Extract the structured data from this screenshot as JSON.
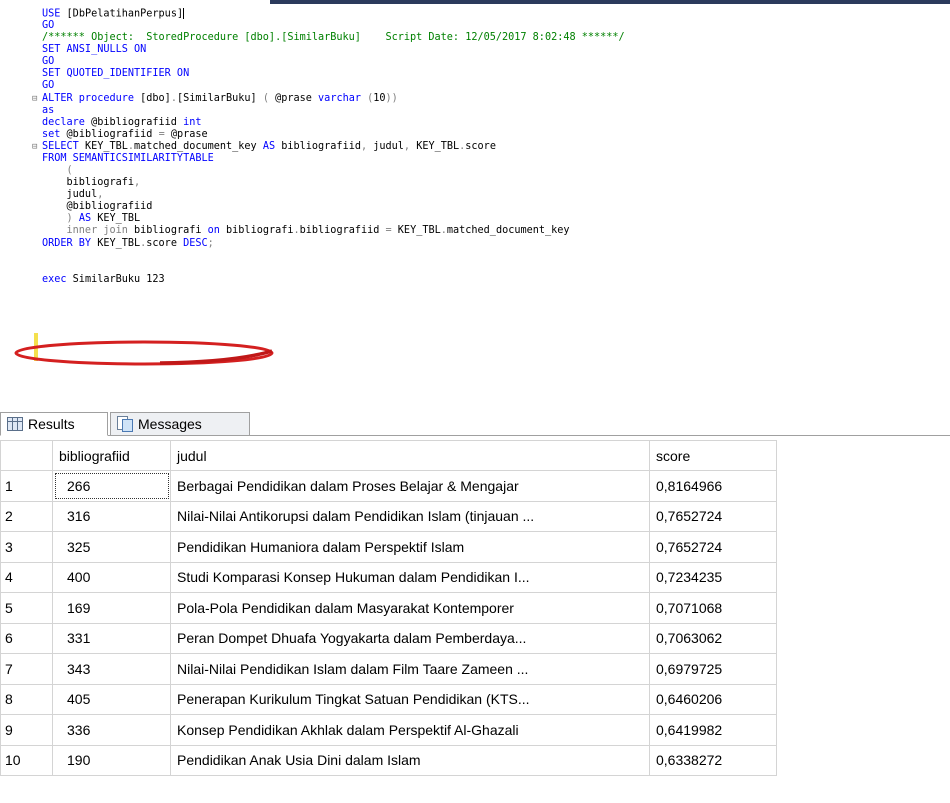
{
  "editor": {
    "lines": [
      {
        "fold": "",
        "parts": [
          {
            "c": "kw",
            "t": "USE "
          },
          {
            "c": "id",
            "t": "[DbPelatihanPerpus]"
          }
        ]
      },
      {
        "fold": "",
        "parts": [
          {
            "c": "kw",
            "t": "GO"
          }
        ]
      },
      {
        "fold": "",
        "parts": [
          {
            "c": "cm",
            "t": "/****** Object:  StoredProcedure [dbo].[SimilarBuku]    Script Date: 12/05/2017 8:02:48 ******/"
          }
        ]
      },
      {
        "fold": "",
        "parts": [
          {
            "c": "kw",
            "t": "SET ANSI_NULLS ON"
          }
        ]
      },
      {
        "fold": "",
        "parts": [
          {
            "c": "kw",
            "t": "GO"
          }
        ]
      },
      {
        "fold": "",
        "parts": [
          {
            "c": "kw",
            "t": "SET QUOTED_IDENTIFIER ON"
          }
        ]
      },
      {
        "fold": "",
        "parts": [
          {
            "c": "kw",
            "t": "GO"
          }
        ]
      },
      {
        "fold": "⊟",
        "parts": [
          {
            "c": "kw",
            "t": "ALTER procedure "
          },
          {
            "c": "id",
            "t": "[dbo]"
          },
          {
            "c": "gr",
            "t": "."
          },
          {
            "c": "id",
            "t": "[SimilarBuku] "
          },
          {
            "c": "gr",
            "t": "( "
          },
          {
            "c": "id",
            "t": "@prase "
          },
          {
            "c": "kw",
            "t": "varchar "
          },
          {
            "c": "gr",
            "t": "("
          },
          {
            "c": "id",
            "t": "10"
          },
          {
            "c": "gr",
            "t": "))"
          }
        ]
      },
      {
        "fold": "",
        "parts": [
          {
            "c": "kw",
            "t": "as"
          }
        ]
      },
      {
        "fold": "",
        "parts": [
          {
            "c": "kw",
            "t": "declare "
          },
          {
            "c": "id",
            "t": "@bibliografiid "
          },
          {
            "c": "kw",
            "t": "int"
          }
        ]
      },
      {
        "fold": "",
        "parts": [
          {
            "c": "kw",
            "t": "set "
          },
          {
            "c": "id",
            "t": "@bibliografiid "
          },
          {
            "c": "gr",
            "t": "= "
          },
          {
            "c": "id",
            "t": "@prase"
          }
        ]
      },
      {
        "fold": "⊟",
        "parts": [
          {
            "c": "kw",
            "t": "SELECT "
          },
          {
            "c": "id",
            "t": "KEY_TBL"
          },
          {
            "c": "gr",
            "t": "."
          },
          {
            "c": "id",
            "t": "matched_document_key "
          },
          {
            "c": "kw",
            "t": "AS "
          },
          {
            "c": "id",
            "t": "bibliografiid"
          },
          {
            "c": "gr",
            "t": ", "
          },
          {
            "c": "id",
            "t": "judul"
          },
          {
            "c": "gr",
            "t": ", "
          },
          {
            "c": "id",
            "t": "KEY_TBL"
          },
          {
            "c": "gr",
            "t": "."
          },
          {
            "c": "id",
            "t": "score"
          }
        ]
      },
      {
        "fold": "",
        "parts": [
          {
            "c": "kw",
            "t": "FROM SEMANTICSIMILARITYTABLE"
          }
        ]
      },
      {
        "fold": "",
        "parts": [
          {
            "c": "gr",
            "t": "    ("
          }
        ]
      },
      {
        "fold": "",
        "parts": [
          {
            "c": "id",
            "t": "    bibliografi"
          },
          {
            "c": "gr",
            "t": ","
          }
        ]
      },
      {
        "fold": "",
        "parts": [
          {
            "c": "id",
            "t": "    judul"
          },
          {
            "c": "gr",
            "t": ","
          }
        ]
      },
      {
        "fold": "",
        "parts": [
          {
            "c": "id",
            "t": "    @bibliografiid"
          }
        ]
      },
      {
        "fold": "",
        "parts": [
          {
            "c": "gr",
            "t": "    ) "
          },
          {
            "c": "kw",
            "t": "AS "
          },
          {
            "c": "id",
            "t": "KEY_TBL"
          }
        ]
      },
      {
        "fold": "",
        "parts": [
          {
            "c": "gr",
            "t": "    inner join "
          },
          {
            "c": "id",
            "t": "bibliografi "
          },
          {
            "c": "kw",
            "t": "on "
          },
          {
            "c": "id",
            "t": "bibliografi"
          },
          {
            "c": "gr",
            "t": "."
          },
          {
            "c": "id",
            "t": "bibliografiid "
          },
          {
            "c": "gr",
            "t": "= "
          },
          {
            "c": "id",
            "t": "KEY_TBL"
          },
          {
            "c": "gr",
            "t": "."
          },
          {
            "c": "id",
            "t": "matched_document_key"
          }
        ]
      },
      {
        "fold": "",
        "parts": [
          {
            "c": "kw",
            "t": "ORDER BY "
          },
          {
            "c": "id",
            "t": "KEY_TBL"
          },
          {
            "c": "gr",
            "t": "."
          },
          {
            "c": "id",
            "t": "score "
          },
          {
            "c": "kw",
            "t": "DESC"
          },
          {
            "c": "gr",
            "t": ";"
          }
        ]
      },
      {
        "fold": "",
        "parts": []
      },
      {
        "fold": "",
        "parts": []
      },
      {
        "fold": "",
        "parts": [
          {
            "c": "kw",
            "t": "exec "
          },
          {
            "c": "id",
            "t": "SimilarBuku 123"
          }
        ]
      }
    ]
  },
  "results": {
    "tabs": {
      "results": "Results",
      "messages": "Messages"
    },
    "columns": [
      "bibliografiid",
      "judul",
      "score"
    ],
    "rows": [
      {
        "n": "1",
        "bibliografiid": "266",
        "judul": "Berbagai Pendidikan dalam Proses Belajar & Mengajar",
        "score": "0,8164966"
      },
      {
        "n": "2",
        "bibliografiid": "316",
        "judul": "Nilai-Nilai Antikorupsi dalam Pendidikan Islam (tinjauan ...",
        "score": "0,7652724"
      },
      {
        "n": "3",
        "bibliografiid": "325",
        "judul": "Pendidikan Humaniora dalam Perspektif Islam",
        "score": "0,7652724"
      },
      {
        "n": "4",
        "bibliografiid": "400",
        "judul": "Studi Komparasi Konsep Hukuman dalam Pendidikan I...",
        "score": "0,7234235"
      },
      {
        "n": "5",
        "bibliografiid": "169",
        "judul": "Pola-Pola Pendidikan dalam Masyarakat Kontemporer",
        "score": "0,7071068"
      },
      {
        "n": "6",
        "bibliografiid": "331",
        "judul": "Peran Dompet Dhuafa Yogyakarta dalam Pemberdaya...",
        "score": "0,7063062"
      },
      {
        "n": "7",
        "bibliografiid": "343",
        "judul": "Nilai-Nilai Pendidikan Islam dalam Film Taare Zameen ...",
        "score": "0,6979725"
      },
      {
        "n": "8",
        "bibliografiid": "405",
        "judul": "Penerapan Kurikulum Tingkat Satuan Pendidikan (KTS...",
        "score": "0,6460206"
      },
      {
        "n": "9",
        "bibliografiid": "336",
        "judul": "Konsep Pendidikan Akhlak dalam Perspektif Al-Ghazali",
        "score": "0,6419982"
      },
      {
        "n": "10",
        "bibliografiid": "190",
        "judul": "Pendidikan Anak Usia Dini dalam Islam",
        "score": "0,6338272"
      }
    ]
  }
}
